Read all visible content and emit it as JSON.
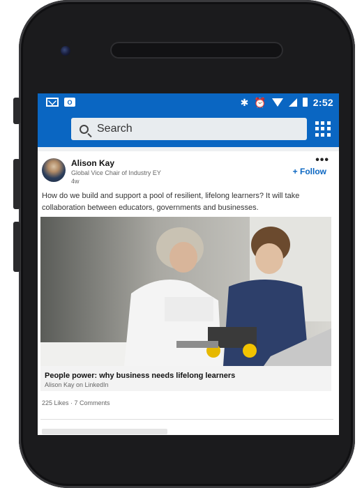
{
  "status_bar": {
    "time": "2:52",
    "left_icons": [
      "gmail-icon",
      "outlook-icon"
    ],
    "right_icons": [
      "bluetooth-icon",
      "alarm-icon",
      "wifi-icon",
      "signal-icon",
      "battery-icon"
    ],
    "outlook_glyph": "O"
  },
  "header": {
    "search_label": "Search",
    "menu_icon": "grid-icon"
  },
  "post": {
    "author_name": "Alison Kay",
    "author_title": "Global Vice Chair of Industry EY",
    "age": "4w",
    "more_label": "•••",
    "follow_label": "+ Follow",
    "text": "How do we build and support a pool of resilient, lifelong learners? It will take collaboration between educators, governments and businesses.",
    "article": {
      "title": "People power: why business needs lifelong learners",
      "source": "Alison Kay on LinkedIn"
    },
    "counts": "225 Likes · 7 Comments"
  },
  "colors": {
    "brand": "#0a66c2",
    "background": "#eef0f2"
  }
}
